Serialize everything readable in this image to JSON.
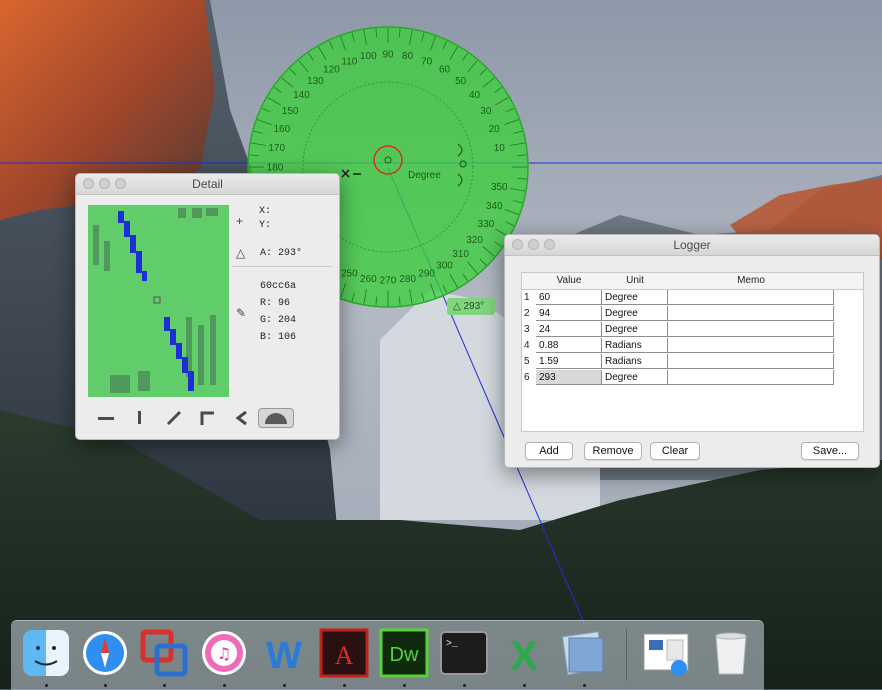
{
  "protractor": {
    "center_label": "Degree",
    "outer_ticks": [
      "10",
      "20",
      "30",
      "40",
      "50",
      "60",
      "70",
      "80",
      "90",
      "100",
      "110",
      "120",
      "130",
      "140",
      "150",
      "160",
      "170",
      "180",
      "190",
      "200",
      "210",
      "220",
      "230",
      "240",
      "250",
      "260",
      "270",
      "280",
      "290",
      "300",
      "310",
      "320",
      "330",
      "340",
      "350"
    ],
    "angle_badge": "293°"
  },
  "detail": {
    "title": "Detail",
    "x_label": "X:",
    "y_label": "Y:",
    "angle_text": "A: 293°",
    "hex": "60cc6a",
    "r_text": "R: 96",
    "g_text": "G: 204",
    "b_text": "B: 106",
    "tools": [
      "horizontal-line-tool",
      "vertical-line-tool",
      "diagonal-line-tool",
      "corner-tool",
      "angle-tool",
      "protractor-tool"
    ]
  },
  "logger": {
    "title": "Logger",
    "columns": [
      "Value",
      "Unit",
      "Memo"
    ],
    "rows": [
      {
        "n": "1",
        "value": "60",
        "unit": "Degree",
        "memo": ""
      },
      {
        "n": "2",
        "value": "94",
        "unit": "Degree",
        "memo": ""
      },
      {
        "n": "3",
        "value": "24",
        "unit": "Degree",
        "memo": ""
      },
      {
        "n": "4",
        "value": "0.88",
        "unit": "Radians",
        "memo": ""
      },
      {
        "n": "5",
        "value": "1.59",
        "unit": "Radians",
        "memo": ""
      },
      {
        "n": "6",
        "value": "293",
        "unit": "Degree",
        "memo": ""
      }
    ],
    "buttons": {
      "add": "Add",
      "remove": "Remove",
      "clear": "Clear",
      "save": "Save..."
    }
  },
  "dock": {
    "apps": [
      "Finder",
      "Safari",
      "Parallels",
      "iTunes",
      "Word",
      "Acrobat",
      "Dreamweaver",
      "Terminal",
      "Excel",
      "Preview",
      "Screenshot",
      "Trash"
    ],
    "labels": {
      "acrobat": "A",
      "dreamweaver": "Dw",
      "terminal": ">_",
      "word": "W",
      "excel": "X"
    }
  },
  "colors": {
    "protractor": "#3ccf3c",
    "guide_line": "#1f2dd8",
    "window_bg": "#ececec",
    "magnifier_bg": "#60cc6a"
  }
}
